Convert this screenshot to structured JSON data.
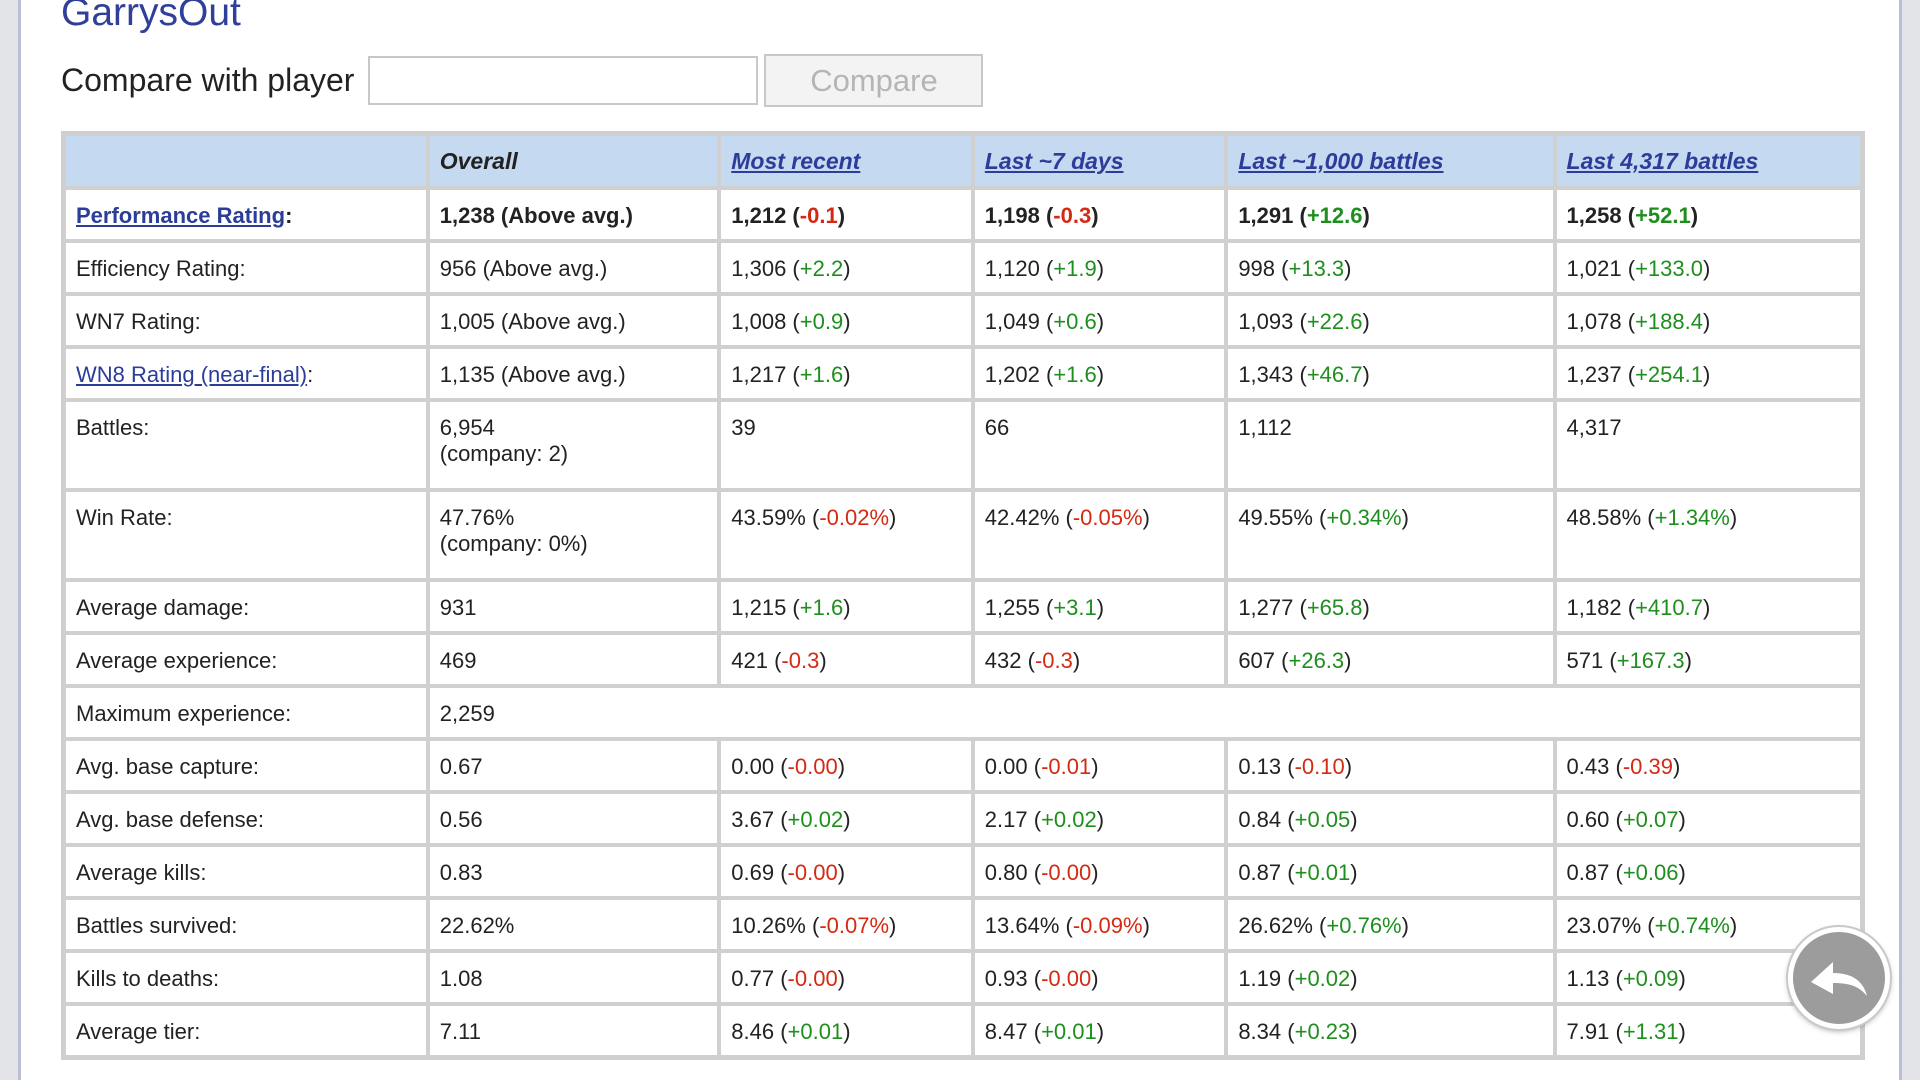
{
  "player_name": "GarrysOut",
  "compare": {
    "label": "Compare with player",
    "input_value": "",
    "button_label": "Compare"
  },
  "table": {
    "columns": [
      "",
      "Overall",
      "Most recent",
      "Last ~7 days",
      "Last ~1,000 battles",
      "Last 4,317 battles"
    ],
    "rows": [
      {
        "label": "Performance Rating",
        "link": true,
        "bold": true,
        "cells": [
          {
            "v": "1,238 (Above avg.)"
          },
          {
            "v": "1,212",
            "d": "-0.1"
          },
          {
            "v": "1,198",
            "d": "-0.3"
          },
          {
            "v": "1,291",
            "d": "+12.6"
          },
          {
            "v": "1,258",
            "d": "+52.1"
          }
        ]
      },
      {
        "label": "Efficiency Rating:",
        "cells": [
          {
            "v": "956 (Above avg.)"
          },
          {
            "v": "1,306",
            "d": "+2.2"
          },
          {
            "v": "1,120",
            "d": "+1.9"
          },
          {
            "v": "998",
            "d": "+13.3"
          },
          {
            "v": "1,021",
            "d": "+133.0"
          }
        ]
      },
      {
        "label": "WN7 Rating:",
        "cells": [
          {
            "v": "1,005 (Above avg.)"
          },
          {
            "v": "1,008",
            "d": "+0.9"
          },
          {
            "v": "1,049",
            "d": "+0.6"
          },
          {
            "v": "1,093",
            "d": "+22.6"
          },
          {
            "v": "1,078",
            "d": "+188.4"
          }
        ]
      },
      {
        "label": "WN8 Rating (near-final)",
        "link": true,
        "cells": [
          {
            "v": "1,135 (Above avg.)"
          },
          {
            "v": "1,217",
            "d": "+1.6"
          },
          {
            "v": "1,202",
            "d": "+1.6"
          },
          {
            "v": "1,343",
            "d": "+46.7"
          },
          {
            "v": "1,237",
            "d": "+254.1"
          }
        ]
      },
      {
        "label": "Battles:",
        "tall": true,
        "cells": [
          {
            "v": "6,954",
            "sub": "(company: 2)"
          },
          {
            "v": "39"
          },
          {
            "v": "66"
          },
          {
            "v": "1,112"
          },
          {
            "v": "4,317"
          }
        ]
      },
      {
        "label": "Win Rate:",
        "tall": true,
        "cells": [
          {
            "v": "47.76%",
            "sub": "(company: 0%)"
          },
          {
            "v": "43.59%",
            "d": "-0.02%"
          },
          {
            "v": "42.42%",
            "d": "-0.05%"
          },
          {
            "v": "49.55%",
            "d": "+0.34%"
          },
          {
            "v": "48.58%",
            "d": "+1.34%"
          }
        ]
      },
      {
        "label": "Average damage:",
        "cells": [
          {
            "v": "931"
          },
          {
            "v": "1,215",
            "d": "+1.6"
          },
          {
            "v": "1,255",
            "d": "+3.1"
          },
          {
            "v": "1,277",
            "d": "+65.8"
          },
          {
            "v": "1,182",
            "d": "+410.7"
          }
        ]
      },
      {
        "label": "Average experience:",
        "cells": [
          {
            "v": "469"
          },
          {
            "v": "421",
            "d": "-0.3"
          },
          {
            "v": "432",
            "d": "-0.3"
          },
          {
            "v": "607",
            "d": "+26.3"
          },
          {
            "v": "571",
            "d": "+167.3"
          }
        ]
      },
      {
        "label": "Maximum experience:",
        "span": true,
        "cells": [
          {
            "v": "2,259"
          }
        ]
      },
      {
        "label": "Avg. base capture:",
        "cells": [
          {
            "v": "0.67"
          },
          {
            "v": "0.00",
            "d": "-0.00"
          },
          {
            "v": "0.00",
            "d": "-0.01"
          },
          {
            "v": "0.13",
            "d": "-0.10"
          },
          {
            "v": "0.43",
            "d": "-0.39"
          }
        ]
      },
      {
        "label": "Avg. base defense:",
        "cells": [
          {
            "v": "0.56"
          },
          {
            "v": "3.67",
            "d": "+0.02"
          },
          {
            "v": "2.17",
            "d": "+0.02"
          },
          {
            "v": "0.84",
            "d": "+0.05"
          },
          {
            "v": "0.60",
            "d": "+0.07"
          }
        ]
      },
      {
        "label": "Average kills:",
        "cells": [
          {
            "v": "0.83"
          },
          {
            "v": "0.69",
            "d": "-0.00"
          },
          {
            "v": "0.80",
            "d": "-0.00"
          },
          {
            "v": "0.87",
            "d": "+0.01"
          },
          {
            "v": "0.87",
            "d": "+0.06"
          }
        ]
      },
      {
        "label": "Battles survived:",
        "cells": [
          {
            "v": "22.62%"
          },
          {
            "v": "10.26%",
            "d": "-0.07%"
          },
          {
            "v": "13.64%",
            "d": "-0.09%"
          },
          {
            "v": "26.62%",
            "d": "+0.76%"
          },
          {
            "v": "23.07%",
            "d": "+0.74%"
          }
        ]
      },
      {
        "label": "Kills to deaths:",
        "cells": [
          {
            "v": "1.08"
          },
          {
            "v": "0.77",
            "d": "-0.00"
          },
          {
            "v": "0.93",
            "d": "-0.00"
          },
          {
            "v": "1.19",
            "d": "+0.02"
          },
          {
            "v": "1.13",
            "d": "+0.09"
          }
        ]
      },
      {
        "label": "Average tier:",
        "cells": [
          {
            "v": "7.11"
          },
          {
            "v": "8.46",
            "d": "+0.01"
          },
          {
            "v": "8.47",
            "d": "+0.01"
          },
          {
            "v": "8.34",
            "d": "+0.23"
          },
          {
            "v": "7.91",
            "d": "+1.31"
          }
        ]
      }
    ]
  },
  "icons": {
    "back_button": "back-arrow-icon"
  },
  "colors": {
    "positive": "#1e8f1e",
    "negative": "#d42a14",
    "header_bg": "#c5d9f1",
    "link": "#2b3d99"
  }
}
